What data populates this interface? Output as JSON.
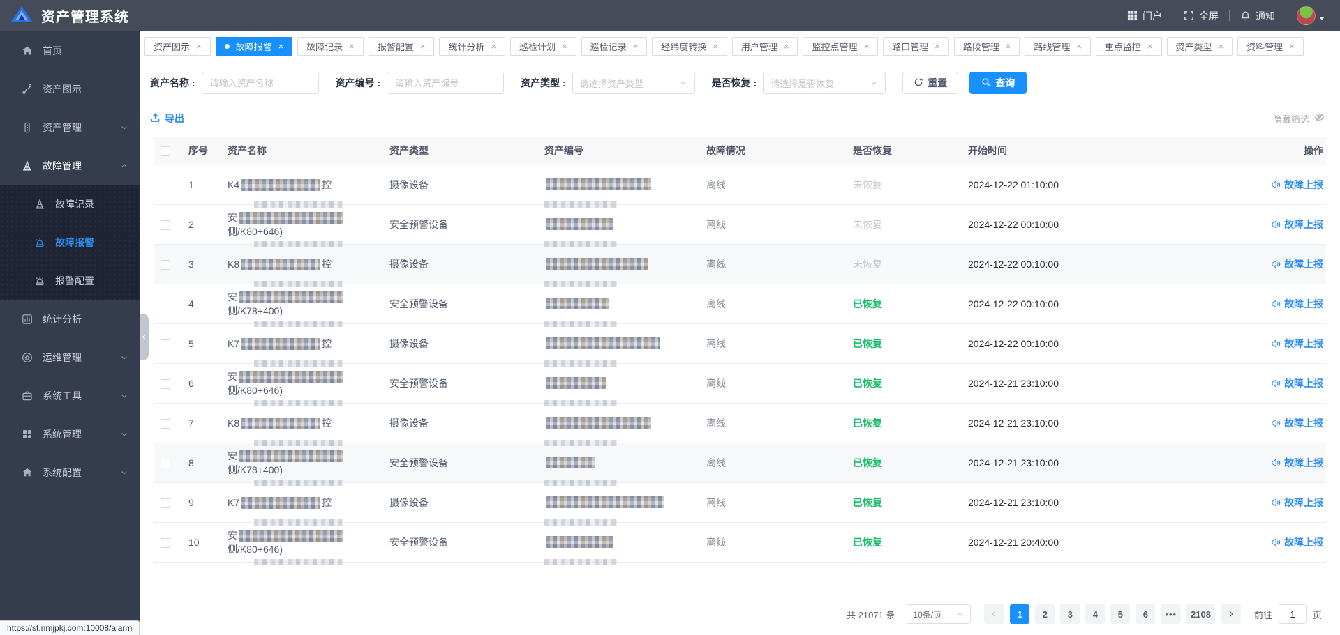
{
  "header": {
    "title": "资产管理系统",
    "portal": "门户",
    "fullscreen": "全屏",
    "notifications": "通知"
  },
  "sidebar": {
    "items": [
      {
        "label": "首页",
        "icon": "home-icon",
        "expandable": false
      },
      {
        "label": "资产图示",
        "icon": "asset-map-icon",
        "expandable": false
      },
      {
        "label": "资产管理",
        "icon": "traffic-light-icon",
        "expandable": true,
        "expanded": false
      },
      {
        "label": "故障管理",
        "icon": "cone-icon",
        "expandable": true,
        "expanded": true,
        "children": [
          {
            "label": "故障记录",
            "icon": "cone-icon",
            "active": false
          },
          {
            "label": "故障报警",
            "icon": "siren-icon",
            "active": true
          },
          {
            "label": "报警配置",
            "icon": "siren-icon",
            "active": false
          }
        ]
      },
      {
        "label": "统计分析",
        "icon": "chart-icon",
        "expandable": false
      },
      {
        "label": "运维管理",
        "icon": "ops-icon",
        "expandable": true,
        "expanded": false
      },
      {
        "label": "系统工具",
        "icon": "toolbox-icon",
        "expandable": true,
        "expanded": false
      },
      {
        "label": "系统管理",
        "icon": "modules-icon",
        "expandable": true,
        "expanded": false
      },
      {
        "label": "系统配置",
        "icon": "config-home-icon",
        "expandable": true,
        "expanded": false
      }
    ]
  },
  "tabs": [
    {
      "label": "资产图示",
      "active": false
    },
    {
      "label": "故障报警",
      "active": true
    },
    {
      "label": "故障记录",
      "active": false
    },
    {
      "label": "报警配置",
      "active": false
    },
    {
      "label": "统计分析",
      "active": false
    },
    {
      "label": "巡检计划",
      "active": false
    },
    {
      "label": "巡检记录",
      "active": false
    },
    {
      "label": "经纬度转换",
      "active": false
    },
    {
      "label": "用户管理",
      "active": false
    },
    {
      "label": "监控点管理",
      "active": false
    },
    {
      "label": "路口管理",
      "active": false
    },
    {
      "label": "路段管理",
      "active": false
    },
    {
      "label": "路线管理",
      "active": false
    },
    {
      "label": "重点监控",
      "active": false
    },
    {
      "label": "资产类型",
      "active": false
    },
    {
      "label": "资料管理",
      "active": false
    }
  ],
  "filters": {
    "name_label": "资产名称 :",
    "name_placeholder": "请输入资产名称",
    "code_label": "资产编号 :",
    "code_placeholder": "请输入资产编号",
    "type_label": "资产类型 :",
    "type_placeholder": "请选择资产类型",
    "recover_label": "是否恢复 :",
    "recover_placeholder": "请选择是否恢复",
    "reset_label": "重置",
    "search_label": "查询"
  },
  "toolbar": {
    "export_label": "导出",
    "hide_filter_label": "隐藏筛选"
  },
  "table": {
    "columns": [
      "序号",
      "资产名称",
      "资产类型",
      "资产编号",
      "故障情况",
      "是否恢复",
      "开始时间",
      "操作"
    ],
    "action_label": "故障上报",
    "rows": [
      {
        "index": "1",
        "name_prefix": "K4",
        "name_suffix": "控",
        "type": "摄像设备",
        "fault": "离线",
        "recovered": "未恢复",
        "recovered_state": "no",
        "start_time": "2024-12-22 01:10:00"
      },
      {
        "index": "2",
        "name_prefix": "安",
        "name_suffix": "侧/K80+646)",
        "type": "安全预警设备",
        "fault": "离线",
        "recovered": "未恢复",
        "recovered_state": "no",
        "start_time": "2024-12-22 00:10:00"
      },
      {
        "index": "3",
        "name_prefix": "K8",
        "name_suffix": "控",
        "type": "摄像设备",
        "fault": "离线",
        "recovered": "未恢复",
        "recovered_state": "no",
        "start_time": "2024-12-22 00:10:00"
      },
      {
        "index": "4",
        "name_prefix": "安",
        "name_suffix": "侧/K78+400)",
        "type": "安全预警设备",
        "fault": "离线",
        "recovered": "已恢复",
        "recovered_state": "yes",
        "start_time": "2024-12-22 00:10:00"
      },
      {
        "index": "5",
        "name_prefix": "K7",
        "name_suffix": "控",
        "type": "摄像设备",
        "fault": "离线",
        "recovered": "已恢复",
        "recovered_state": "yes",
        "start_time": "2024-12-22 00:10:00"
      },
      {
        "index": "6",
        "name_prefix": "安",
        "name_suffix": "侧/K80+646)",
        "type": "安全预警设备",
        "fault": "离线",
        "recovered": "已恢复",
        "recovered_state": "yes",
        "start_time": "2024-12-21 23:10:00"
      },
      {
        "index": "7",
        "name_prefix": "K8",
        "name_suffix": "控",
        "type": "摄像设备",
        "fault": "离线",
        "recovered": "已恢复",
        "recovered_state": "yes",
        "start_time": "2024-12-21 23:10:00"
      },
      {
        "index": "8",
        "name_prefix": "安",
        "name_suffix": "侧/K78+400)",
        "type": "安全预警设备",
        "fault": "离线",
        "recovered": "已恢复",
        "recovered_state": "yes",
        "start_time": "2024-12-21 23:10:00"
      },
      {
        "index": "9",
        "name_prefix": "K7",
        "name_suffix": "控",
        "type": "摄像设备",
        "fault": "离线",
        "recovered": "已恢复",
        "recovered_state": "yes",
        "start_time": "2024-12-21 23:10:00"
      },
      {
        "index": "10",
        "name_prefix": "安",
        "name_suffix": "侧/K80+646)",
        "type": "安全预警设备",
        "fault": "离线",
        "recovered": "已恢复",
        "recovered_state": "yes",
        "start_time": "2024-12-21 20:40:00"
      }
    ]
  },
  "pagination": {
    "total": "共 21071 条",
    "page_size": "10条/页",
    "pages": [
      "1",
      "2",
      "3",
      "4",
      "5",
      "6",
      "•••",
      "2108"
    ],
    "active_page": "1",
    "goto_label": "前往",
    "goto_value": "1",
    "page_unit": "页"
  },
  "status_bar": {
    "url": "https://st.nmjpkj.com:10008/alarm"
  }
}
